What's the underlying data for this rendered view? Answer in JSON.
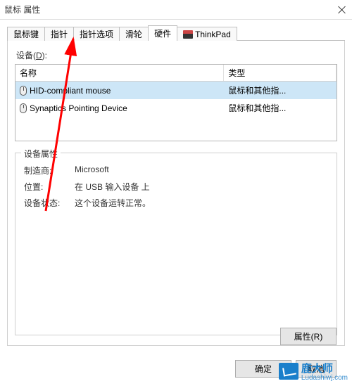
{
  "window": {
    "title": "鼠标 属性"
  },
  "tabs": {
    "items": [
      {
        "label": "鼠标键"
      },
      {
        "label": "指针"
      },
      {
        "label": "指针选项"
      },
      {
        "label": "滑轮"
      },
      {
        "label": "硬件"
      },
      {
        "label": "ThinkPad"
      }
    ]
  },
  "devices": {
    "heading_prefix": "设备(",
    "heading_key": "D",
    "heading_suffix": "):",
    "columns": {
      "name": "名称",
      "type": "类型"
    },
    "rows": [
      {
        "name": "HID-compliant mouse",
        "type": "鼠标和其他指...",
        "selected": true
      },
      {
        "name": "Synaptics Pointing Device",
        "type": "鼠标和其他指...",
        "selected": false
      }
    ]
  },
  "props": {
    "title": "设备属性",
    "manufacturer_label": "制造商:",
    "manufacturer_value": "Microsoft",
    "location_label": "位置:",
    "location_value": "在 USB 输入设备 上",
    "status_label": "设备状态:",
    "status_value": "这个设备运转正常。",
    "properties_button": "属性(R)"
  },
  "footer": {
    "ok": "确定",
    "cancel": "取消"
  },
  "watermark": {
    "name": "鹿大师",
    "url": "Ludashiwj.com"
  }
}
